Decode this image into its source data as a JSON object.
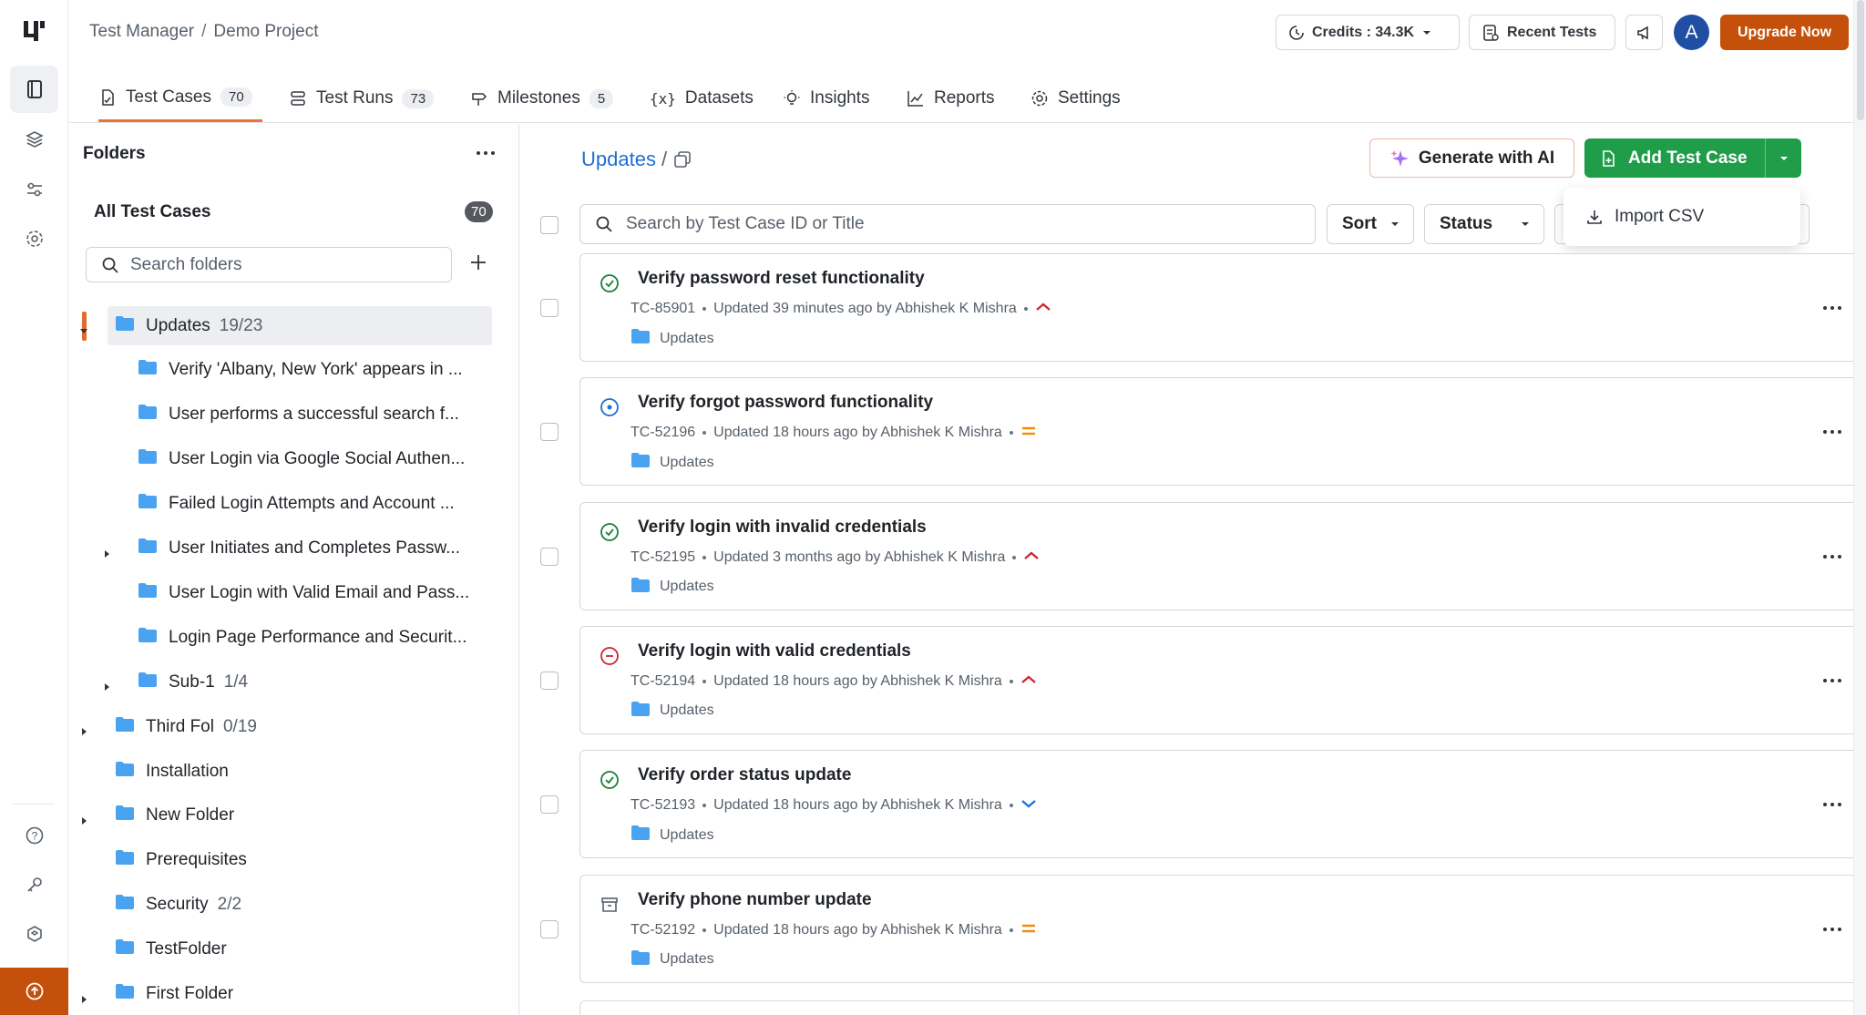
{
  "app": {
    "breadcrumb": [
      "Test Manager",
      "Demo Project"
    ],
    "separator": "/",
    "credits_label": "Credits : 34.3K",
    "recent_tests_label": "Recent Tests",
    "avatar_initial": "A",
    "upgrade_label": "Upgrade Now",
    "accent": "#c4500b"
  },
  "rail": {
    "icons": [
      "test-management-icon",
      "layers-icon",
      "sliders-icon",
      "settings-icon",
      "help-icon",
      "key-icon",
      "integrations-icon",
      "upload-icon"
    ]
  },
  "tabs": [
    {
      "label": "Test Cases",
      "count": "70",
      "icon": "test-cases-icon",
      "active": true
    },
    {
      "label": "Test Runs",
      "count": "73",
      "icon": "test-runs-icon"
    },
    {
      "label": "Milestones",
      "count": "5",
      "icon": "milestone-icon"
    },
    {
      "label": "Datasets",
      "icon": "dataset-icon"
    },
    {
      "label": "Insights",
      "icon": "bulb-icon"
    },
    {
      "label": "Reports",
      "icon": "chart-icon"
    },
    {
      "label": "Settings",
      "icon": "gear-icon"
    }
  ],
  "folders": {
    "title": "Folders",
    "all_label": "All Test Cases",
    "all_count": "70",
    "search_placeholder": "Search folders",
    "items": [
      {
        "name": "Updates",
        "count": "19/23",
        "level": 0,
        "caret": "down",
        "selected": true
      },
      {
        "name": "Verify 'Albany, New York' appears in ...",
        "level": 1
      },
      {
        "name": "User performs a successful search f...",
        "level": 1
      },
      {
        "name": "User Login via Google Social Authen...",
        "level": 1
      },
      {
        "name": "Failed Login Attempts and Account ...",
        "level": 1
      },
      {
        "name": "User Initiates and Completes Passw...",
        "level": 1,
        "caret": "right"
      },
      {
        "name": "User Login with Valid Email and Pass...",
        "level": 1
      },
      {
        "name": "Login Page Performance and Securit...",
        "level": 1
      },
      {
        "name": "Sub-1",
        "count": "1/4",
        "level": 1,
        "caret": "right"
      },
      {
        "name": "Third Fol",
        "count": "0/19",
        "level": 0,
        "caret": "right"
      },
      {
        "name": "Installation",
        "level": 0
      },
      {
        "name": "New Folder",
        "level": 0,
        "caret": "right"
      },
      {
        "name": "Prerequisites",
        "level": 0
      },
      {
        "name": "Security",
        "count": "2/2",
        "level": 0
      },
      {
        "name": "TestFolder",
        "level": 0
      },
      {
        "name": "First Folder",
        "level": 0,
        "caret": "right"
      }
    ]
  },
  "main": {
    "path_label": "Updates",
    "path_sep": "/",
    "generate_ai_label": "Generate with AI",
    "add_test_case_label": "Add Test Case",
    "import_csv_label": "Import CSV",
    "search_placeholder": "Search by Test Case ID or Title",
    "sort_label": "Sort",
    "status_label": "Status"
  },
  "test_cases": [
    {
      "title": "Verify password reset functionality",
      "id": "TC-85901",
      "updated": "Updated 39 minutes ago by Abhishek K Mishra",
      "folder": "Updates",
      "status": "approved",
      "priority": "high"
    },
    {
      "title": "Verify forgot password functionality",
      "id": "TC-52196",
      "updated": "Updated 18 hours ago by Abhishek K Mishra",
      "folder": "Updates",
      "status": "in-progress",
      "priority": "medium"
    },
    {
      "title": "Verify login with invalid credentials",
      "id": "TC-52195",
      "updated": "Updated 3 months ago by Abhishek K Mishra",
      "folder": "Updates",
      "status": "approved",
      "priority": "high"
    },
    {
      "title": "Verify login with valid credentials",
      "id": "TC-52194",
      "updated": "Updated 18 hours ago by Abhishek K Mishra",
      "folder": "Updates",
      "status": "rejected",
      "priority": "high"
    },
    {
      "title": "Verify order status update",
      "id": "TC-52193",
      "updated": "Updated 18 hours ago by Abhishek K Mishra",
      "folder": "Updates",
      "status": "approved",
      "priority": "low"
    },
    {
      "title": "Verify phone number update",
      "id": "TC-52192",
      "updated": "Updated 18 hours ago by Abhishek K Mishra",
      "folder": "Updates",
      "status": "archived",
      "priority": "medium"
    }
  ],
  "colors": {
    "approved": "#1a7f37",
    "in_progress": "#1f6fd1",
    "rejected": "#cf222e",
    "archived": "#57606a",
    "priority_high": "#cf222e",
    "priority_medium": "#f08c00",
    "priority_low": "#1f6fd1",
    "folder": "#4aa3f0",
    "primary_green": "#1f9d49"
  }
}
